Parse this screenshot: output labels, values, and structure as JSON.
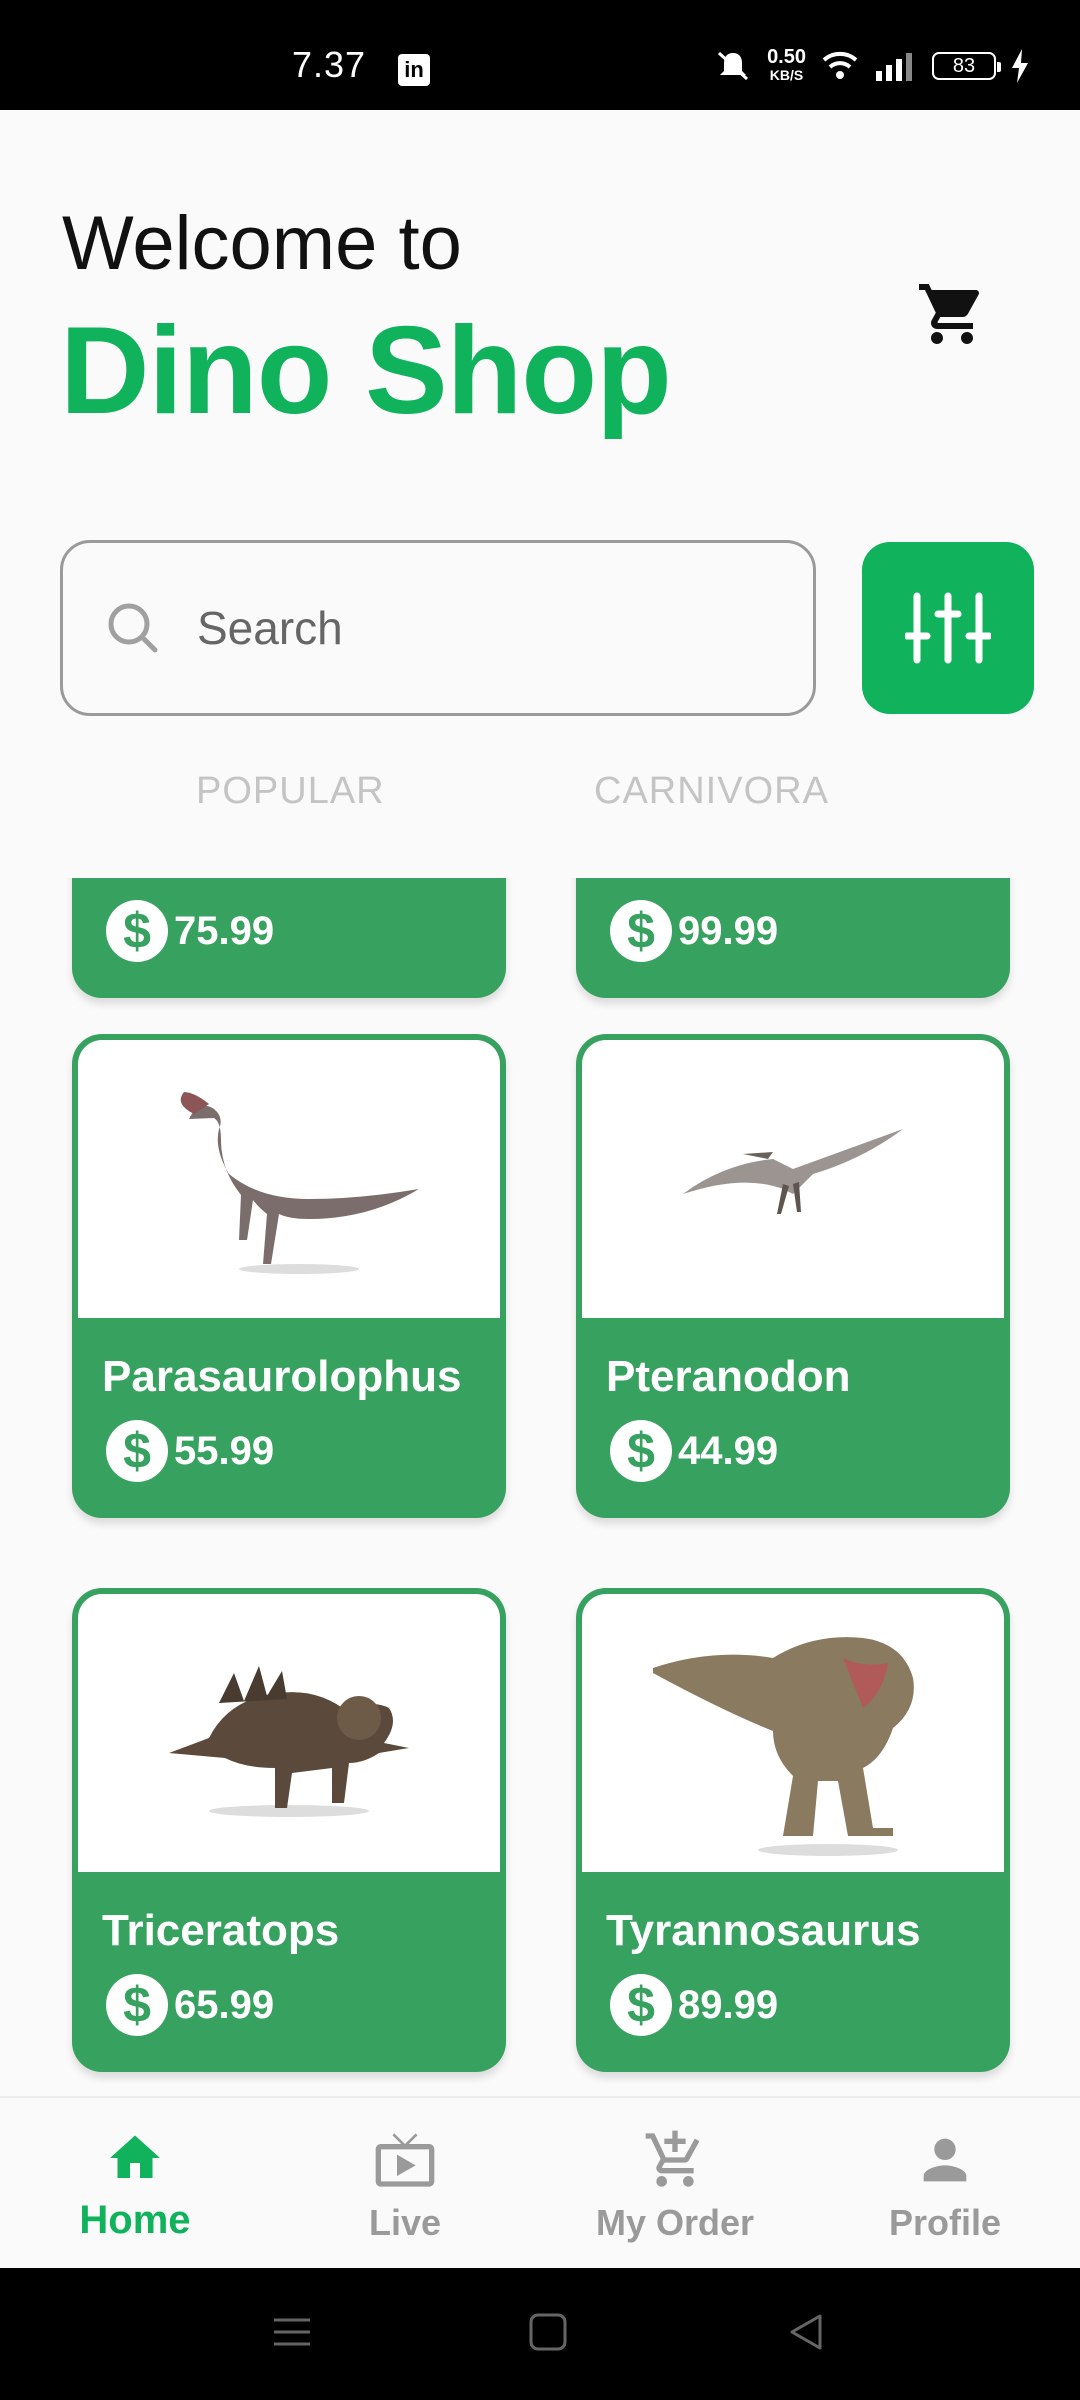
{
  "status_bar": {
    "time": "7.37",
    "app_badge": "in",
    "net_speed": "0.50",
    "net_unit": "KB/S",
    "battery": "83"
  },
  "header": {
    "welcome": "Welcome to",
    "brand": "Dino Shop"
  },
  "search": {
    "placeholder": "Search"
  },
  "tabs": [
    "POPULAR",
    "CARNIVORA"
  ],
  "partial_cards": [
    {
      "price": "75.99"
    },
    {
      "price": "99.99"
    }
  ],
  "products": [
    {
      "name": "Parasaurolophus",
      "price": "55.99"
    },
    {
      "name": "Pteranodon",
      "price": "44.99"
    },
    {
      "name": "Triceratops",
      "price": "65.99"
    },
    {
      "name": "Tyrannosaurus",
      "price": "89.99"
    }
  ],
  "currency_symbol": "$",
  "bottom_nav": [
    {
      "label": "Home",
      "icon": "home-icon",
      "active": true
    },
    {
      "label": "Live",
      "icon": "live-tv-icon",
      "active": false
    },
    {
      "label": "My Order",
      "icon": "cart-add-icon",
      "active": false
    },
    {
      "label": "Profile",
      "icon": "person-icon",
      "active": false
    }
  ],
  "colors": {
    "brand_green": "#10b35c",
    "card_green": "#37a160",
    "inactive_gray": "#9a9a9a"
  }
}
